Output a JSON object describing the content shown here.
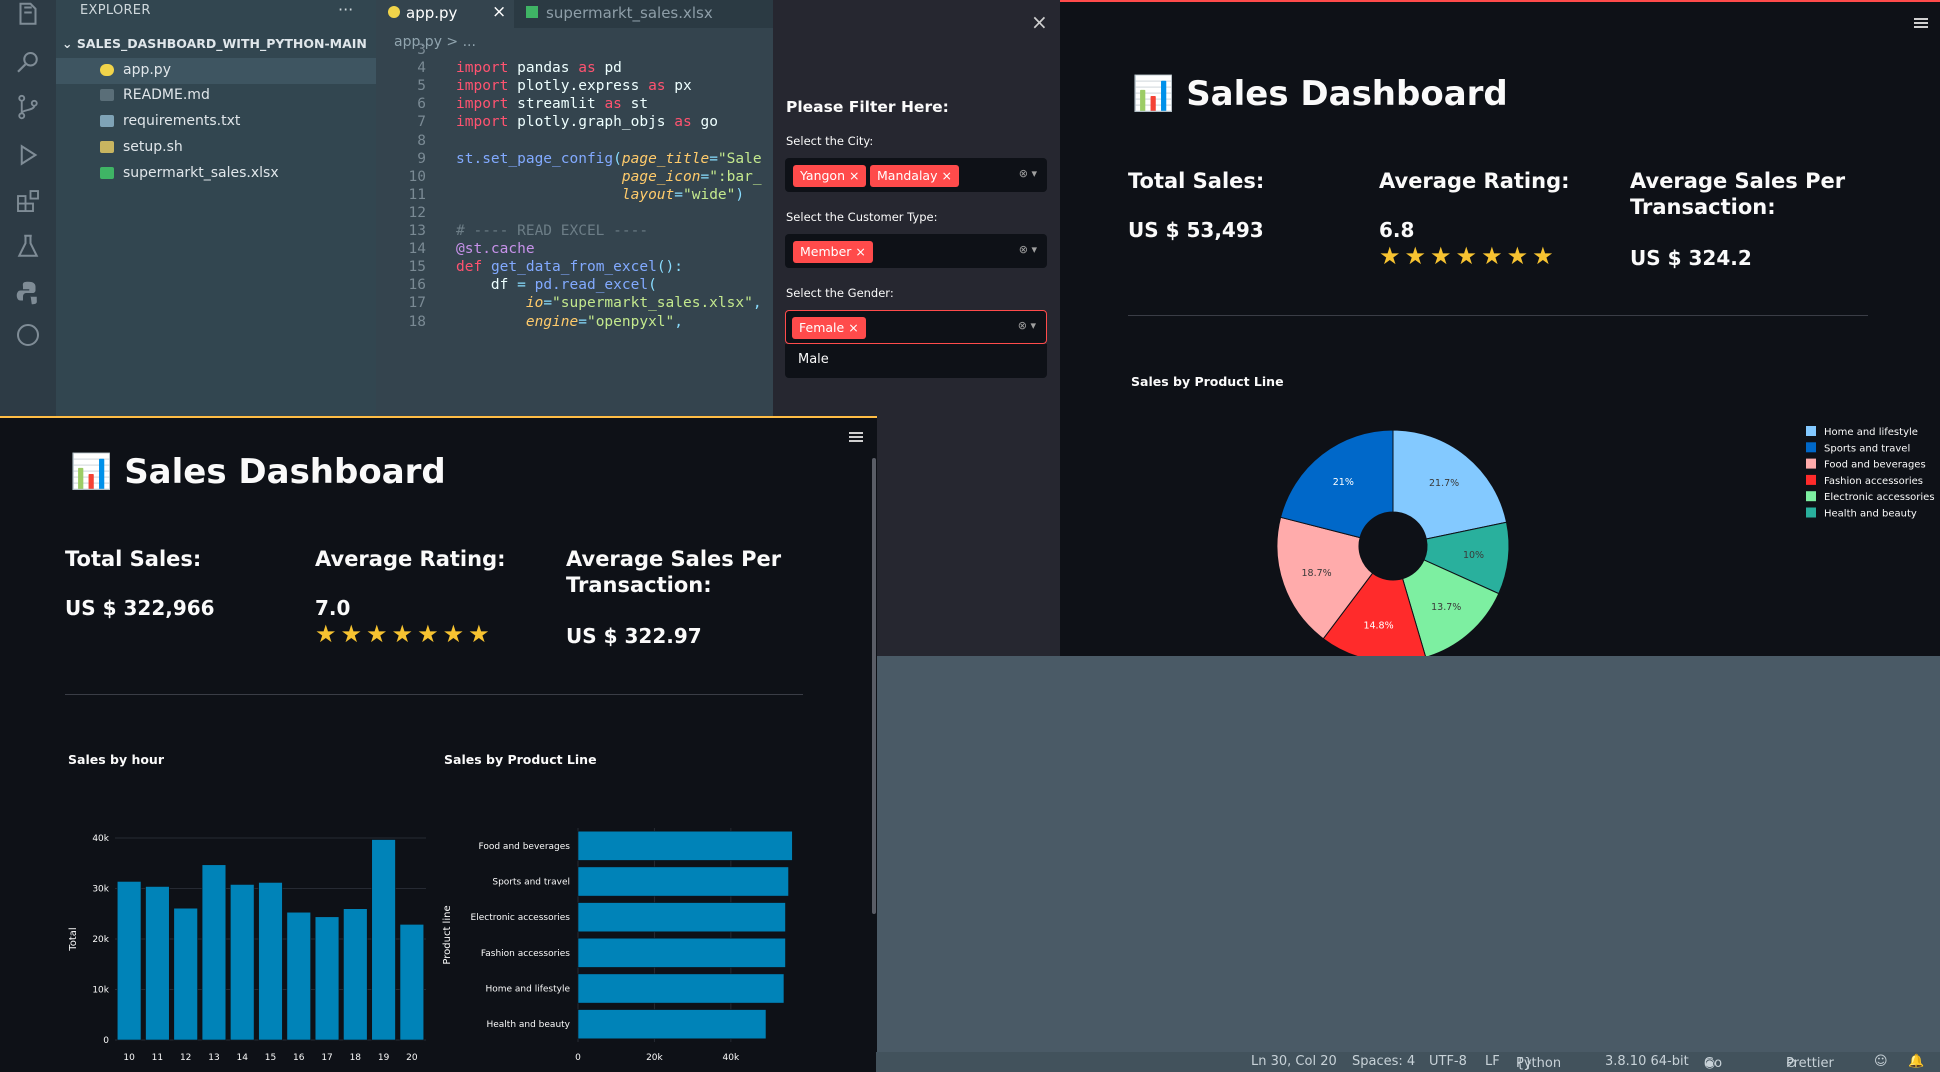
{
  "vscode": {
    "explorer": {
      "header": "EXPLORER",
      "more": "···",
      "project": "SALES_DASHBOARD_WITH_PYTHON-MAIN",
      "files": [
        {
          "name": "app.py",
          "icon_color": "#f1d44a"
        },
        {
          "name": "README.md",
          "icon_color": "#5a6e78"
        },
        {
          "name": "requirements.txt",
          "icon_color": "#7fa3b6"
        },
        {
          "name": "setup.sh",
          "icon_color": "#c8b560"
        },
        {
          "name": "supermarkt_sales.xlsx",
          "icon_color": "#3fb465"
        }
      ]
    },
    "tabs": [
      {
        "label": "app.py",
        "close": "×"
      },
      {
        "label": "supermarkt_sales.xlsx"
      }
    ],
    "breadcrumb": "app.py  >  ...",
    "code": [
      {
        "n": "3",
        "t": ""
      },
      {
        "n": "4",
        "t": "import pandas as pd"
      },
      {
        "n": "5",
        "t": "import plotly.express as px"
      },
      {
        "n": "6",
        "t": "import streamlit as st"
      },
      {
        "n": "7",
        "t": "import plotly.graph_objs as go"
      },
      {
        "n": "8",
        "t": ""
      },
      {
        "n": "9",
        "t": "st.set_page_config(page_title=\"Sale"
      },
      {
        "n": "10",
        "t": "                   page_icon=\":bar_"
      },
      {
        "n": "11",
        "t": "                   layout=\"wide\")"
      },
      {
        "n": "12",
        "t": ""
      },
      {
        "n": "13",
        "t": "# ---- READ EXCEL ----"
      },
      {
        "n": "14",
        "t": "@st.cache"
      },
      {
        "n": "15",
        "t": "def get_data_from_excel():"
      },
      {
        "n": "16",
        "t": "    df = pd.read_excel("
      },
      {
        "n": "17",
        "t": "        io=\"supermarkt_sales.xlsx\","
      },
      {
        "n": "18",
        "t": "        engine=\"openpyxl\","
      }
    ],
    "status": [
      "Ln 30, Col 20",
      "Spaces: 4",
      "UTF-8",
      "LF",
      "Python",
      "3.8.10 64-bit",
      "Go Live",
      "Prettier"
    ]
  },
  "sidebar": {
    "close": "×",
    "heading": "Please Filter Here:",
    "city_label": "Select the City:",
    "city_values": [
      "Yangon",
      "Mandalay"
    ],
    "customer_label": "Select the Customer Type:",
    "customer_values": [
      "Member"
    ],
    "gender_label": "Select the Gender:",
    "gender_values": [
      "Female"
    ],
    "gender_option": "Male",
    "chip_x": "×",
    "controls": "⊗ ▾"
  },
  "dash_right": {
    "icon": "📊",
    "title": "Sales Dashboard",
    "kpi": {
      "total_label": "Total Sales:",
      "total_value": "US $ 53,493",
      "rating_label": "Average Rating:",
      "rating_value": "6.8",
      "stars": "★★★★★★★",
      "avg_label": "Average Sales Per Transaction:",
      "avg_value": "US $ 324.2"
    },
    "chart_title": "Sales by Product Line"
  },
  "dash_left": {
    "icon": "📊",
    "title": "Sales Dashboard",
    "kpi": {
      "total_label": "Total Sales:",
      "total_value": "US $ 322,966",
      "rating_label": "Average Rating:",
      "rating_value": "7.0",
      "stars": "★★★★★★★",
      "avg_label": "Average Sales Per Transaction:",
      "avg_value": "US $ 322.97"
    },
    "hour_title": "Sales by hour",
    "prod_title": "Sales by Product Line"
  },
  "chart_data": [
    {
      "type": "pie",
      "title": "Sales by Product Line",
      "hole": true,
      "categories": [
        "Home and lifestyle",
        "Sports and travel",
        "Food and beverages",
        "Fashion accessories",
        "Electronic accessories",
        "Health and beauty"
      ],
      "values": [
        21.7,
        21.0,
        18.7,
        14.8,
        13.7,
        10.0
      ],
      "labels": [
        "21.7%",
        "21%",
        "18.7%",
        "14.8%",
        "13.7%",
        "10%"
      ],
      "slice_order": [
        0,
        5,
        4,
        3,
        2,
        1
      ],
      "colors": [
        "#83c9ff",
        "#0068c9",
        "#ffabab",
        "#ff2b2b",
        "#7defa1",
        "#29b09d"
      ],
      "legend": "right"
    },
    {
      "type": "bar",
      "title": "Sales by hour",
      "categories": [
        "10",
        "11",
        "12",
        "13",
        "14",
        "15",
        "16",
        "17",
        "18",
        "19",
        "20"
      ],
      "values": [
        31400,
        30400,
        26100,
        34700,
        30800,
        31200,
        25300,
        24400,
        26000,
        39700,
        22900
      ],
      "ylabel": "Total",
      "ylim": [
        0,
        40000
      ],
      "yticks": [
        "0",
        "10k",
        "20k",
        "30k",
        "40k"
      ],
      "color": "#0083b8"
    },
    {
      "type": "bar",
      "orientation": "horizontal",
      "title": "Sales by Product Line",
      "categories": [
        "Food and beverages",
        "Sports and travel",
        "Electronic accessories",
        "Fashion accessories",
        "Home and lifestyle",
        "Health and beauty"
      ],
      "values": [
        56100,
        55100,
        54300,
        54300,
        53900,
        49200
      ],
      "ylabel": "Product line",
      "xlim": [
        0,
        56000
      ],
      "xticks": [
        "0",
        "20k",
        "40k"
      ],
      "color": "#0083b8"
    }
  ]
}
